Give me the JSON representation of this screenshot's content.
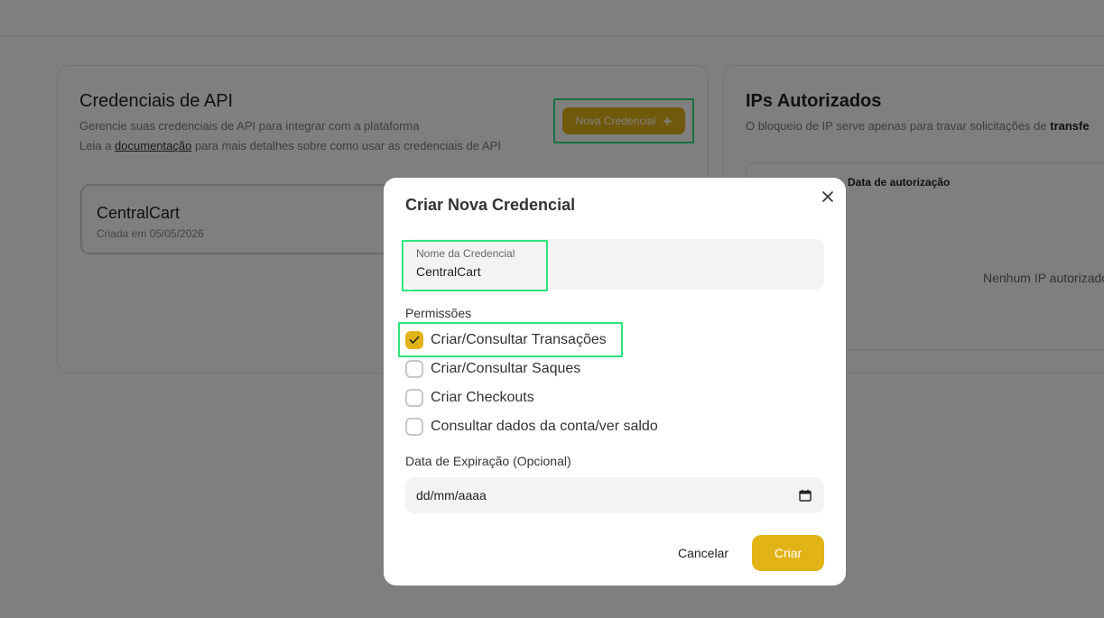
{
  "api_card": {
    "title": "Credenciais de API",
    "desc1": "Gerencie suas credenciais de API para integrar com a plataforma",
    "desc2_prefix": "Leia a ",
    "desc2_link": "documentação",
    "desc2_suffix": " para mais detalhes sobre como usar as credenciais de API",
    "new_button": "Nova Credencial",
    "credentials": [
      {
        "name": "CentralCart",
        "created": "Criada em 05/05/2026"
      }
    ]
  },
  "ips_card": {
    "title": "IPs Autorizados",
    "desc_prefix": "O bloqueio de IP serve apenas para travar solicitações de ",
    "desc_bold": "transfe",
    "table_header_date": "Data de autorização",
    "empty": "Nenhum IP autorizado"
  },
  "modal": {
    "title": "Criar Nova Credencial",
    "name_field": {
      "label": "Nome da Credencial",
      "value": "CentralCart"
    },
    "permissions_title": "Permissões",
    "permissions": [
      {
        "label": "Criar/Consultar Transações",
        "checked": true
      },
      {
        "label": "Criar/Consultar Saques",
        "checked": false
      },
      {
        "label": "Criar Checkouts",
        "checked": false
      },
      {
        "label": "Consultar dados da conta/ver saldo",
        "checked": false
      }
    ],
    "expiration_label": "Data de Expiração (Opcional)",
    "expiration_placeholder": "dd/mm/aaaa",
    "cancel_label": "Cancelar",
    "create_label": "Criar"
  },
  "colors": {
    "accent": "#e2b316",
    "highlight": "#2ee37c"
  }
}
